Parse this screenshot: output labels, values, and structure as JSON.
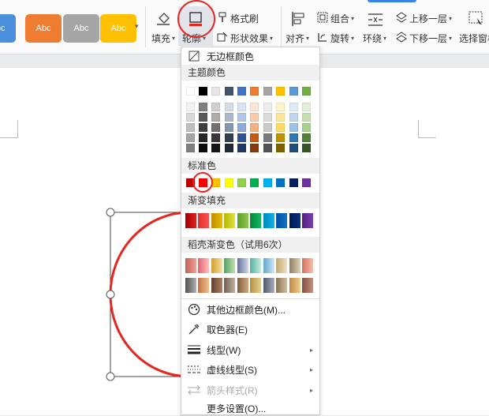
{
  "ribbon": {
    "style_presets": [
      {
        "label": "Abc",
        "color": "#4a8fdc"
      },
      {
        "label": "Abc",
        "color": "#ee7d31"
      },
      {
        "label": "Abc",
        "color": "#a5a5a5"
      },
      {
        "label": "Abc",
        "color": "#ffc000"
      }
    ],
    "fill_label": "填充",
    "outline_label": "轮廓",
    "format_painter_label": "格式刷",
    "shape_effects_label": "形状效果",
    "align_label": "对齐",
    "group_label": "组合",
    "rotate_label": "旋转",
    "wrap_label": "环绕",
    "bring_forward_label": "上移一层",
    "send_backward_label": "下移一层",
    "selection_pane_label": "选择窗格"
  },
  "menu": {
    "no_border_label": "无边框颜色",
    "theme_colors_header": "主题颜色",
    "theme_top_row": [
      "#ffffff",
      "#000000",
      "#e7e6e6",
      "#44546a",
      "#4472c4",
      "#ed7d31",
      "#a5a5a5",
      "#ffc000",
      "#5b9bd5",
      "#70ad47"
    ],
    "theme_shades": [
      [
        "#f2f2f2",
        "#7f7f7f",
        "#d0cece",
        "#d6dce4",
        "#d9e2f3",
        "#fbe5d5",
        "#ededed",
        "#fff2cc",
        "#deebf6",
        "#e2efd9"
      ],
      [
        "#d8d8d8",
        "#595959",
        "#aeabab",
        "#adb9ca",
        "#b4c6e7",
        "#f7cbac",
        "#dbdbdb",
        "#fee599",
        "#bdd7ee",
        "#c5e0b3"
      ],
      [
        "#bfbfbf",
        "#3f3f3f",
        "#757070",
        "#8496b0",
        "#8eaadb",
        "#f4b183",
        "#c9c9c9",
        "#ffd965",
        "#9cc3e5",
        "#a8d08d"
      ],
      [
        "#a5a5a5",
        "#262626",
        "#3a3838",
        "#323f4f",
        "#2f5496",
        "#c55a11",
        "#7b7b7b",
        "#bf9000",
        "#2e75b5",
        "#538135"
      ],
      [
        "#7f7f7f",
        "#0c0c0c",
        "#171616",
        "#222a35",
        "#1f3864",
        "#833c0b",
        "#525252",
        "#7f6000",
        "#1e4e79",
        "#375623"
      ]
    ],
    "standard_colors_header": "标准色",
    "standard_colors": [
      "#c00000",
      "#ff0000",
      "#ffc000",
      "#ffff00",
      "#92d050",
      "#00b050",
      "#00b0f0",
      "#0070c0",
      "#002060",
      "#7030a0"
    ],
    "gradient_fill_header": "渐变填充",
    "gradient_fill": [
      [
        "#a00000",
        "#e02020"
      ],
      [
        "#e03030",
        "#ff5050"
      ],
      [
        "#c09000",
        "#e8b800"
      ],
      [
        "#b8b800",
        "#e0e040"
      ],
      [
        "#5a9e2a",
        "#8cc850"
      ],
      [
        "#00883a",
        "#10b860"
      ],
      [
        "#0088c0",
        "#10b0e8"
      ],
      [
        "#0050a0",
        "#1070c8"
      ],
      [
        "#001850",
        "#0a3080"
      ],
      [
        "#552080",
        "#7a40b0"
      ]
    ],
    "shiny_gradient_header": "稻壳渐变色（试用6次）",
    "shiny_row1": [
      [
        "#c0605a",
        "#f0a090"
      ],
      [
        "#e06070",
        "#ffc0c0"
      ],
      [
        "#d0a030",
        "#f8e0a0"
      ],
      [
        "#50a060",
        "#c0e0b0"
      ],
      [
        "#6070a0",
        "#d0d8e8"
      ],
      [
        "#50b0a0",
        "#c8ece0"
      ],
      [
        "#60a8d0",
        "#d0e8f8"
      ],
      [
        "#c0a870",
        "#f0e0c0"
      ],
      [
        "#908060",
        "#e0d0b8"
      ],
      [
        "#d07060",
        "#f8c0a8"
      ]
    ],
    "shiny_row2": [
      [
        "#505050",
        "#b0b0b0"
      ],
      [
        "#c07040",
        "#f0c090"
      ],
      [
        "#604030",
        "#b08060"
      ],
      [
        "#706050",
        "#c0b0a0"
      ],
      [
        "#806040",
        "#d0a880"
      ],
      [
        "#b09040",
        "#e8d090"
      ],
      [
        "#505868",
        "#a8b0c0"
      ],
      [
        "#887050",
        "#d0c0a0"
      ],
      [
        "#c08840",
        "#f0d090"
      ],
      [
        "#805040",
        "#c89080"
      ]
    ],
    "more_border_colors_label": "其他边框颜色(M)...",
    "eyedropper_label": "取色器(E)",
    "line_type_label": "线型(W)",
    "dash_type_label": "虚线线型(S)",
    "arrow_style_label": "箭头样式(R)",
    "more_settings_label": "更多设置(O)..."
  }
}
